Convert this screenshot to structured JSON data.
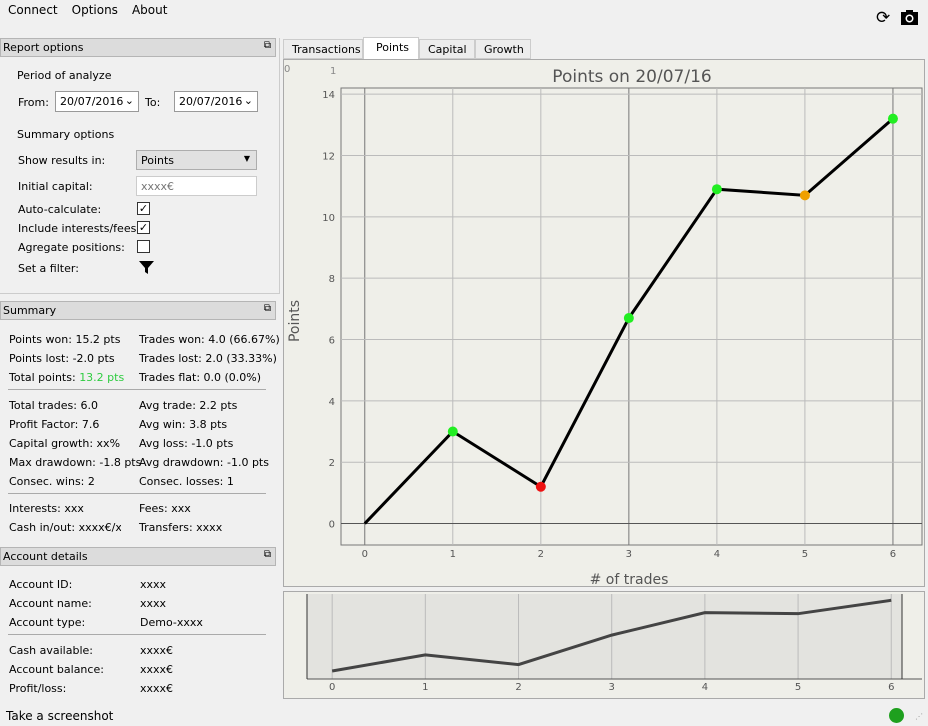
{
  "menu": [
    "Connect",
    "Options",
    "About"
  ],
  "report": {
    "title": "Report options",
    "period_label": "Period of analyze",
    "from_label": "From:",
    "from": "20/07/2016",
    "to_label": "To:",
    "to": "20/07/2016",
    "summary_label": "Summary options",
    "show_label": "Show results in:",
    "show_value": "Points",
    "capital_label": "Initial capital:",
    "capital_placeholder": "xxxx€",
    "auto_label": "Auto-calculate:",
    "interest_label": "Include interests/fees:",
    "aggregate_label": "Agregate positions:",
    "filter_label": "Set a filter:"
  },
  "summary": {
    "title": "Summary",
    "left": [
      "Points won: 15.2 pts",
      "Points lost: -2.0 pts",
      "Total points: "
    ],
    "total_value": "13.2 pts",
    "right": [
      "Trades won: 4.0 (66.67%)",
      "Trades lost: 2.0 (33.33%)",
      "Trades flat: 0.0 (0.0%)"
    ],
    "left2": [
      "Total trades: 6.0",
      "Profit Factor: 7.6",
      "Capital growth: xx%",
      "Max drawdown: -1.8 pts",
      "Consec. wins: 2"
    ],
    "right2": [
      "Avg trade: 2.2 pts",
      "Avg win: 3.8 pts",
      "Avg loss: -1.0 pts",
      "Avg drawdown: -1.0 pts",
      "Consec. losses: 1"
    ],
    "left3": [
      "Interests: xxx",
      "Cash in/out: xxxx€/xxx"
    ],
    "right3": [
      "Fees: xxx",
      "Transfers: xxxx"
    ],
    "green": "#2ecc40"
  },
  "account": {
    "title": "Account details",
    "rows": [
      [
        "Account ID:",
        "xxxx"
      ],
      [
        "Account name:",
        "xxxx"
      ],
      [
        "Account type:",
        "Demo-xxxx"
      ]
    ],
    "rows2": [
      [
        "Cash available:",
        "xxxx€"
      ],
      [
        "Account balance:",
        "xxxx€"
      ],
      [
        "Profit/loss:",
        "xxxx€"
      ]
    ]
  },
  "tabs": [
    "Transactions",
    "Points",
    "Capital",
    "Growth"
  ],
  "corner_labels": [
    "0",
    "1"
  ],
  "status": {
    "text": "Take a screenshot",
    "indicator": "#1ea01e"
  },
  "chart_data": {
    "type": "line",
    "title": "Points on 20/07/16",
    "xlabel": "# of trades",
    "ylabel": "Points",
    "x": [
      0,
      1,
      2,
      3,
      4,
      5,
      6
    ],
    "y": [
      0,
      3,
      1.2,
      6.7,
      10.9,
      10.7,
      13.2
    ],
    "marker_colors": [
      null,
      "#22ee22",
      "#ee1111",
      "#22ee22",
      "#22ee22",
      "#f0a000",
      "#22ee22"
    ],
    "xlim": [
      -0.27,
      6.33
    ],
    "ylim": [
      -0.7,
      14.2
    ],
    "yticks": [
      0,
      2,
      4,
      6,
      8,
      10,
      12,
      14
    ],
    "xticks": [
      0,
      1,
      2,
      3,
      4,
      5,
      6
    ],
    "grid": true
  }
}
